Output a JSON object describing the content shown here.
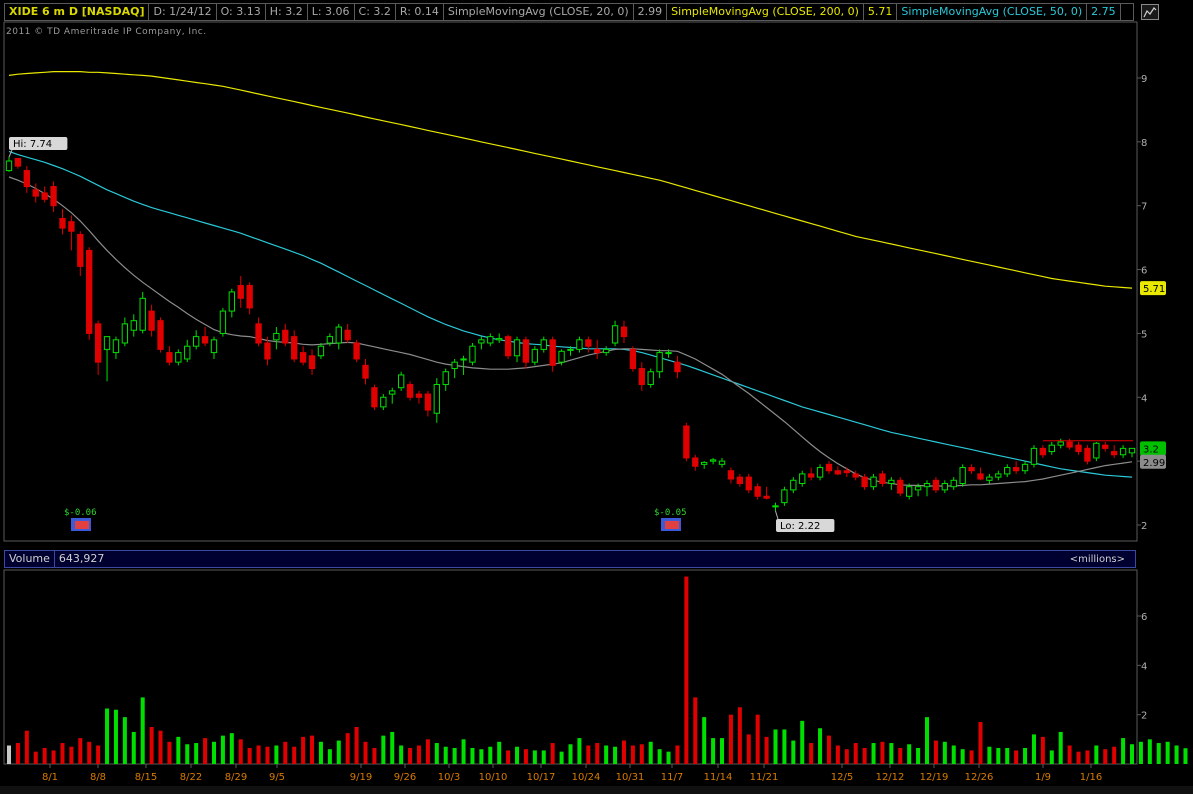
{
  "header": {
    "symbol": "XIDE 6 m D [NASDAQ]",
    "date": "D: 1/24/12",
    "open": "O: 3.13",
    "high": "H: 3.2",
    "low": "L: 3.06",
    "close": "C: 3.2",
    "range": "R: 0.14",
    "sma20_label": "SimpleMovingAvg (CLOSE, 20, 0)",
    "sma20_value": "2.99",
    "sma200_label": "SimpleMovingAvg (CLOSE, 200, 0)",
    "sma200_value": "5.71",
    "sma50_label": "SimpleMovingAvg (CLOSE, 50, 0)",
    "sma50_value": "2.75"
  },
  "copyright": "2011 © TD Ameritrade IP Company, Inc.",
  "volume_header": {
    "label": "Volume",
    "value": "643,927",
    "units": "<millions>"
  },
  "colors": {
    "up": "#00e000",
    "down": "#e00000",
    "sma20": "#8c8c8c",
    "sma50": "#2ac8d8",
    "sma200": "#e8e800",
    "axis": "#5a5a5a"
  },
  "chart_data": [
    {
      "type": "candlestick",
      "title": "XIDE 6 m D [NASDAQ]",
      "ylim": [
        2.0,
        9.5
      ],
      "yticks": [
        "9",
        "8",
        "7",
        "6",
        "5",
        "4",
        "3",
        "2"
      ],
      "x_labels": [
        "8/1",
        "8/8",
        "8/15",
        "8/22",
        "8/29",
        "9/5",
        "9/19",
        "9/26",
        "10/3",
        "10/10",
        "10/17",
        "10/24",
        "10/31",
        "11/7",
        "11/14",
        "11/21",
        "12/5",
        "12/12",
        "12/19",
        "12/26",
        "1/9",
        "1/16"
      ],
      "annotations": {
        "hi": "Hi: 7.74",
        "lo": "Lo: 2.22",
        "div1": "$-0.06",
        "div2": "$-0.05"
      },
      "last_price_badges": {
        "sma200": "5.71",
        "close": "3.2",
        "sma20": "2.99"
      },
      "candles": [
        [
          7.55,
          7.76,
          7.53,
          7.7
        ],
        [
          7.74,
          7.74,
          7.58,
          7.62
        ],
        [
          7.55,
          7.62,
          7.2,
          7.3
        ],
        [
          7.25,
          7.35,
          7.05,
          7.15
        ],
        [
          7.2,
          7.3,
          7.05,
          7.1
        ],
        [
          7.3,
          7.38,
          6.9,
          7.0
        ],
        [
          6.8,
          6.95,
          6.55,
          6.65
        ],
        [
          6.75,
          6.85,
          6.3,
          6.6
        ],
        [
          6.55,
          6.6,
          5.9,
          6.05
        ],
        [
          6.3,
          6.35,
          4.9,
          5.0
        ],
        [
          5.15,
          5.2,
          4.35,
          4.55
        ],
        [
          4.75,
          4.85,
          4.25,
          4.95
        ],
        [
          4.7,
          4.95,
          4.6,
          4.9
        ],
        [
          4.85,
          5.25,
          4.8,
          5.15
        ],
        [
          5.05,
          5.3,
          4.95,
          5.2
        ],
        [
          5.05,
          5.65,
          5.0,
          5.55
        ],
        [
          5.35,
          5.45,
          4.95,
          5.05
        ],
        [
          5.2,
          5.25,
          4.7,
          4.75
        ],
        [
          4.7,
          4.8,
          4.5,
          4.55
        ],
        [
          4.55,
          4.75,
          4.5,
          4.7
        ],
        [
          4.6,
          4.9,
          4.55,
          4.8
        ],
        [
          4.8,
          5.05,
          4.75,
          4.95
        ],
        [
          4.95,
          5.1,
          4.8,
          4.85
        ],
        [
          4.7,
          4.95,
          4.6,
          4.9
        ],
        [
          5.0,
          5.4,
          4.95,
          5.35
        ],
        [
          5.35,
          5.7,
          5.25,
          5.65
        ],
        [
          5.75,
          5.9,
          5.4,
          5.55
        ],
        [
          5.75,
          5.8,
          5.3,
          5.4
        ],
        [
          5.15,
          5.25,
          4.8,
          4.85
        ],
        [
          4.85,
          4.95,
          4.5,
          4.6
        ],
        [
          4.9,
          5.1,
          4.75,
          5.0
        ],
        [
          5.05,
          5.15,
          4.8,
          4.85
        ],
        [
          4.95,
          5.05,
          4.55,
          4.6
        ],
        [
          4.7,
          4.8,
          4.5,
          4.55
        ],
        [
          4.65,
          4.75,
          4.35,
          4.45
        ],
        [
          4.65,
          4.85,
          4.6,
          4.8
        ],
        [
          4.85,
          5.0,
          4.8,
          4.95
        ],
        [
          4.85,
          5.15,
          4.75,
          5.1
        ],
        [
          5.05,
          5.15,
          4.85,
          4.9
        ],
        [
          4.85,
          4.9,
          4.55,
          4.6
        ],
        [
          4.5,
          4.6,
          4.2,
          4.3
        ],
        [
          4.15,
          4.2,
          3.8,
          3.85
        ],
        [
          3.85,
          4.05,
          3.8,
          4.0
        ],
        [
          4.05,
          4.15,
          3.9,
          4.1
        ],
        [
          4.15,
          4.4,
          4.1,
          4.35
        ],
        [
          4.2,
          4.25,
          3.95,
          4.0
        ],
        [
          4.05,
          4.1,
          3.9,
          4.0
        ],
        [
          4.05,
          4.1,
          3.7,
          3.8
        ],
        [
          3.75,
          4.3,
          3.6,
          4.2
        ],
        [
          4.2,
          4.45,
          4.1,
          4.4
        ],
        [
          4.45,
          4.6,
          4.3,
          4.55
        ],
        [
          4.6,
          4.65,
          4.35,
          4.6
        ],
        [
          4.55,
          4.85,
          4.5,
          4.8
        ],
        [
          4.85,
          4.95,
          4.75,
          4.9
        ],
        [
          4.85,
          5.0,
          4.8,
          4.95
        ],
        [
          4.9,
          5.0,
          4.85,
          4.92
        ],
        [
          4.95,
          4.98,
          4.6,
          4.65
        ],
        [
          4.65,
          4.95,
          4.55,
          4.9
        ],
        [
          4.9,
          4.95,
          4.45,
          4.55
        ],
        [
          4.55,
          4.8,
          4.5,
          4.75
        ],
        [
          4.75,
          4.95,
          4.7,
          4.9
        ],
        [
          4.9,
          4.95,
          4.4,
          4.5
        ],
        [
          4.55,
          4.75,
          4.5,
          4.72
        ],
        [
          4.75,
          4.8,
          4.65,
          4.75
        ],
        [
          4.75,
          4.95,
          4.7,
          4.9
        ],
        [
          4.9,
          4.95,
          4.7,
          4.8
        ],
        [
          4.75,
          4.9,
          4.6,
          4.7
        ],
        [
          4.7,
          4.8,
          4.65,
          4.75
        ],
        [
          4.85,
          5.2,
          4.8,
          5.12
        ],
        [
          5.1,
          5.2,
          4.85,
          4.95
        ],
        [
          4.75,
          4.8,
          4.4,
          4.45
        ],
        [
          4.45,
          4.55,
          4.1,
          4.2
        ],
        [
          4.2,
          4.45,
          4.15,
          4.4
        ],
        [
          4.4,
          4.75,
          4.3,
          4.7
        ],
        [
          4.7,
          4.75,
          4.62,
          4.7
        ],
        [
          4.55,
          4.65,
          4.3,
          4.4
        ],
        [
          3.55,
          3.6,
          3.0,
          3.05
        ],
        [
          3.05,
          3.1,
          2.85,
          2.92
        ],
        [
          2.95,
          3.0,
          2.88,
          2.98
        ],
        [
          3.0,
          3.05,
          2.95,
          3.02
        ],
        [
          2.95,
          3.05,
          2.9,
          3.0
        ],
        [
          2.85,
          2.9,
          2.65,
          2.72
        ],
        [
          2.75,
          2.8,
          2.6,
          2.65
        ],
        [
          2.75,
          2.8,
          2.5,
          2.55
        ],
        [
          2.6,
          2.65,
          2.4,
          2.45
        ],
        [
          2.45,
          2.6,
          2.4,
          2.42
        ],
        [
          2.3,
          2.35,
          2.22,
          2.3
        ],
        [
          2.35,
          2.6,
          2.3,
          2.55
        ],
        [
          2.55,
          2.75,
          2.5,
          2.7
        ],
        [
          2.65,
          2.85,
          2.6,
          2.8
        ],
        [
          2.8,
          2.9,
          2.7,
          2.75
        ],
        [
          2.75,
          2.95,
          2.7,
          2.9
        ],
        [
          2.95,
          3.0,
          2.8,
          2.85
        ],
        [
          2.85,
          2.92,
          2.78,
          2.8
        ],
        [
          2.85,
          2.9,
          2.75,
          2.82
        ],
        [
          2.8,
          2.85,
          2.7,
          2.75
        ],
        [
          2.75,
          2.8,
          2.55,
          2.6
        ],
        [
          2.6,
          2.8,
          2.55,
          2.75
        ],
        [
          2.8,
          2.85,
          2.6,
          2.65
        ],
        [
          2.65,
          2.75,
          2.55,
          2.7
        ],
        [
          2.7,
          2.75,
          2.45,
          2.5
        ],
        [
          2.45,
          2.65,
          2.4,
          2.6
        ],
        [
          2.55,
          2.65,
          2.45,
          2.6
        ],
        [
          2.6,
          2.7,
          2.45,
          2.65
        ],
        [
          2.7,
          2.75,
          2.5,
          2.55
        ],
        [
          2.55,
          2.7,
          2.5,
          2.65
        ],
        [
          2.6,
          2.75,
          2.55,
          2.7
        ],
        [
          2.65,
          2.95,
          2.6,
          2.9
        ],
        [
          2.9,
          2.95,
          2.8,
          2.85
        ],
        [
          2.8,
          2.9,
          2.7,
          2.72
        ],
        [
          2.7,
          2.8,
          2.65,
          2.75
        ],
        [
          2.75,
          2.85,
          2.7,
          2.8
        ],
        [
          2.8,
          2.95,
          2.75,
          2.9
        ],
        [
          2.9,
          3.0,
          2.8,
          2.85
        ],
        [
          2.85,
          3.0,
          2.8,
          2.95
        ],
        [
          2.95,
          3.25,
          2.9,
          3.2
        ],
        [
          3.2,
          3.25,
          3.05,
          3.1
        ],
        [
          3.15,
          3.3,
          3.1,
          3.25
        ],
        [
          3.25,
          3.35,
          3.2,
          3.3
        ],
        [
          3.3,
          3.35,
          3.18,
          3.22
        ],
        [
          3.25,
          3.3,
          3.1,
          3.15
        ],
        [
          3.2,
          3.25,
          2.95,
          3.0
        ],
        [
          3.05,
          3.3,
          3.0,
          3.28
        ],
        [
          3.25,
          3.3,
          3.15,
          3.2
        ],
        [
          3.15,
          3.25,
          3.05,
          3.1
        ],
        [
          3.1,
          3.25,
          3.05,
          3.2
        ],
        [
          3.13,
          3.2,
          3.06,
          3.2
        ]
      ],
      "sma20": [
        7.45,
        7.4,
        7.34,
        7.27,
        7.19,
        7.1,
        7.0,
        6.89,
        6.76,
        6.61,
        6.45,
        6.3,
        6.16,
        6.03,
        5.91,
        5.8,
        5.7,
        5.6,
        5.5,
        5.41,
        5.31,
        5.22,
        5.14,
        5.06,
        5.01,
        4.98,
        4.96,
        4.95,
        4.92,
        4.89,
        4.87,
        4.86,
        4.85,
        4.83,
        4.82,
        4.83,
        4.84,
        4.85,
        4.86,
        4.85,
        4.82,
        4.79,
        4.76,
        4.73,
        4.7,
        4.67,
        4.63,
        4.59,
        4.55,
        4.52,
        4.5,
        4.48,
        4.46,
        4.45,
        4.44,
        4.44,
        4.44,
        4.45,
        4.46,
        4.48,
        4.5,
        4.52,
        4.54,
        4.58,
        4.62,
        4.66,
        4.69,
        4.72,
        4.75,
        4.76,
        4.76,
        4.75,
        4.74,
        4.73,
        4.73,
        4.72,
        4.66,
        4.6,
        4.52,
        4.44,
        4.36,
        4.26,
        4.16,
        4.06,
        3.95,
        3.84,
        3.73,
        3.62,
        3.5,
        3.38,
        3.26,
        3.15,
        3.05,
        2.96,
        2.88,
        2.8,
        2.74,
        2.7,
        2.67,
        2.65,
        2.63,
        2.62,
        2.62,
        2.61,
        2.61,
        2.61,
        2.61,
        2.62,
        2.63,
        2.63,
        2.64,
        2.65,
        2.66,
        2.67,
        2.68,
        2.7,
        2.72,
        2.75,
        2.78,
        2.81,
        2.84,
        2.87,
        2.9,
        2.93,
        2.95,
        2.97,
        2.99
      ],
      "sma50": [
        7.85,
        7.8,
        7.76,
        7.72,
        7.68,
        7.63,
        7.58,
        7.52,
        7.46,
        7.39,
        7.32,
        7.25,
        7.19,
        7.13,
        7.07,
        7.02,
        6.97,
        6.93,
        6.89,
        6.85,
        6.81,
        6.77,
        6.73,
        6.69,
        6.65,
        6.61,
        6.57,
        6.52,
        6.47,
        6.42,
        6.37,
        6.32,
        6.27,
        6.22,
        6.16,
        6.1,
        6.03,
        5.96,
        5.89,
        5.82,
        5.75,
        5.68,
        5.61,
        5.54,
        5.47,
        5.4,
        5.33,
        5.26,
        5.2,
        5.14,
        5.09,
        5.04,
        5.0,
        4.96,
        4.93,
        4.9,
        4.88,
        4.86,
        4.84,
        4.83,
        4.82,
        4.8,
        4.79,
        4.78,
        4.77,
        4.76,
        4.76,
        4.76,
        4.76,
        4.75,
        4.73,
        4.7,
        4.66,
        4.62,
        4.58,
        4.54,
        4.5,
        4.45,
        4.4,
        4.35,
        4.3,
        4.25,
        4.2,
        4.15,
        4.1,
        4.05,
        4.0,
        3.95,
        3.9,
        3.85,
        3.81,
        3.77,
        3.73,
        3.69,
        3.65,
        3.61,
        3.57,
        3.53,
        3.49,
        3.45,
        3.42,
        3.39,
        3.36,
        3.33,
        3.3,
        3.27,
        3.24,
        3.21,
        3.18,
        3.15,
        3.12,
        3.09,
        3.06,
        3.03,
        3.0,
        2.97,
        2.94,
        2.91,
        2.88,
        2.86,
        2.84,
        2.82,
        2.8,
        2.78,
        2.77,
        2.76,
        2.75
      ],
      "sma200": [
        9.04,
        9.06,
        9.07,
        9.08,
        9.09,
        9.1,
        9.1,
        9.1,
        9.1,
        9.09,
        9.09,
        9.08,
        9.07,
        9.06,
        9.05,
        9.04,
        9.03,
        9.01,
        8.99,
        8.97,
        8.95,
        8.93,
        8.91,
        8.89,
        8.87,
        8.84,
        8.81,
        8.78,
        8.75,
        8.72,
        8.69,
        8.66,
        8.63,
        8.6,
        8.57,
        8.54,
        8.51,
        8.48,
        8.45,
        8.42,
        8.39,
        8.36,
        8.33,
        8.3,
        8.27,
        8.24,
        8.21,
        8.18,
        8.15,
        8.12,
        8.09,
        8.06,
        8.03,
        8.0,
        7.97,
        7.94,
        7.91,
        7.88,
        7.85,
        7.82,
        7.79,
        7.76,
        7.73,
        7.7,
        7.67,
        7.64,
        7.61,
        7.58,
        7.55,
        7.52,
        7.49,
        7.46,
        7.43,
        7.4,
        7.36,
        7.32,
        7.28,
        7.24,
        7.2,
        7.16,
        7.12,
        7.08,
        7.04,
        7.0,
        6.96,
        6.92,
        6.88,
        6.84,
        6.8,
        6.76,
        6.72,
        6.68,
        6.64,
        6.6,
        6.56,
        6.52,
        6.49,
        6.46,
        6.43,
        6.4,
        6.37,
        6.34,
        6.31,
        6.28,
        6.25,
        6.22,
        6.19,
        6.16,
        6.13,
        6.1,
        6.07,
        6.04,
        6.01,
        5.98,
        5.95,
        5.92,
        5.89,
        5.86,
        5.84,
        5.82,
        5.8,
        5.78,
        5.76,
        5.74,
        5.73,
        5.72,
        5.71
      ]
    },
    {
      "type": "bar",
      "title": "Volume",
      "ylabel": "millions",
      "ylim": [
        0,
        8
      ],
      "yticks": [
        "6",
        "4",
        "2"
      ],
      "values": [
        0.75,
        0.85,
        1.35,
        0.5,
        0.65,
        0.55,
        0.85,
        0.7,
        1.05,
        0.9,
        0.75,
        2.25,
        2.2,
        1.9,
        1.3,
        2.7,
        1.5,
        1.35,
        0.9,
        1.1,
        0.8,
        0.85,
        1.05,
        0.9,
        1.15,
        1.25,
        1.0,
        0.65,
        0.75,
        0.7,
        0.75,
        0.9,
        0.7,
        1.1,
        1.15,
        0.9,
        0.6,
        0.95,
        1.25,
        1.5,
        0.9,
        0.65,
        1.15,
        1.3,
        0.75,
        0.65,
        0.75,
        1.0,
        0.85,
        0.7,
        0.65,
        1.0,
        0.65,
        0.6,
        0.7,
        0.9,
        0.55,
        0.7,
        0.6,
        0.55,
        0.55,
        0.85,
        0.5,
        0.8,
        1.05,
        0.75,
        0.85,
        0.75,
        0.7,
        0.95,
        0.75,
        0.8,
        0.9,
        0.6,
        0.5,
        0.75,
        7.6,
        2.7,
        1.9,
        1.05,
        1.05,
        2.0,
        2.3,
        1.2,
        2.0,
        1.1,
        1.4,
        1.4,
        0.95,
        1.75,
        0.85,
        1.45,
        1.15,
        0.75,
        0.6,
        0.85,
        0.65,
        0.85,
        0.9,
        0.85,
        0.65,
        0.8,
        0.65,
        1.9,
        0.95,
        0.9,
        0.75,
        0.6,
        0.55,
        1.7,
        0.7,
        0.65,
        0.65,
        0.55,
        0.65,
        1.2,
        1.1,
        0.55,
        1.3,
        0.75,
        0.5,
        0.55,
        0.75,
        0.6,
        0.7,
        1.05,
        0.8,
        0.9,
        1.0,
        0.85,
        0.9,
        0.75,
        0.64
      ],
      "x_labels": [
        "8/1",
        "8/8",
        "8/15",
        "8/22",
        "8/29",
        "9/5",
        "9/19",
        "9/26",
        "10/3",
        "10/10",
        "10/17",
        "10/24",
        "10/31",
        "11/7",
        "11/14",
        "11/21",
        "12/5",
        "12/12",
        "12/19",
        "12/26",
        "1/9",
        "1/16"
      ]
    }
  ]
}
